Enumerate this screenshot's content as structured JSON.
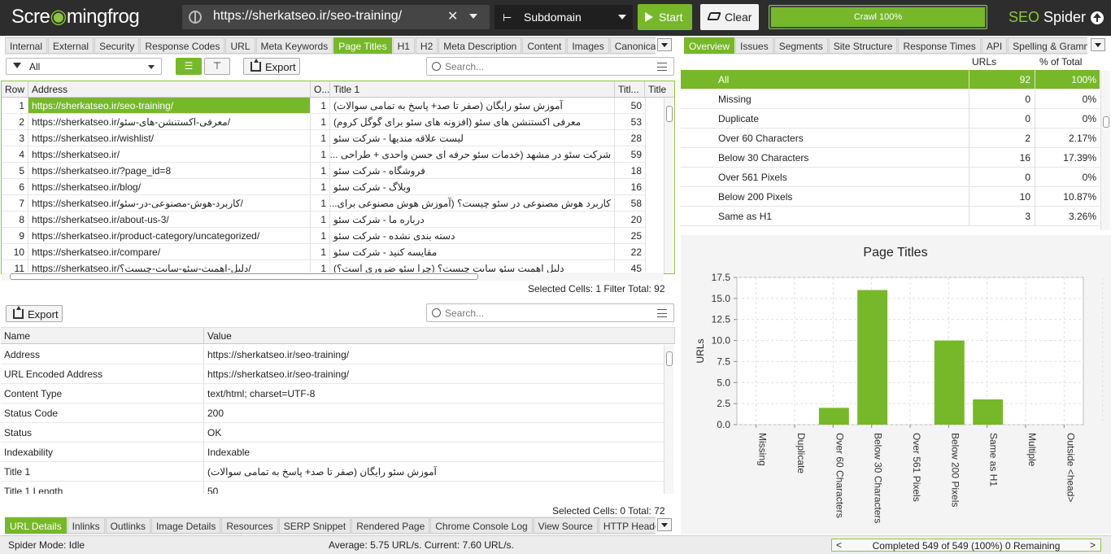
{
  "app": {
    "logo_a": "Scre",
    "logo_b": "mingfrog",
    "product_a": "SEO",
    "product_b": " Spider"
  },
  "toolbar": {
    "url": "https://sherkatseo.ir/seo-training/",
    "clear_x": "✕",
    "mode": "Subdomain",
    "start_label": "Start",
    "clear_label": "Clear",
    "crawl_label": "Crawl 100%",
    "crawl_progress": 1.0
  },
  "left_tabs": [
    "Internal",
    "External",
    "Security",
    "Response Codes",
    "URL",
    "Meta Keywords",
    "Page Titles",
    "H1",
    "H2",
    "Meta Description",
    "Content",
    "Images",
    "Canonica"
  ],
  "left_tabs_active": 6,
  "right_tabs": [
    "Overview",
    "Issues",
    "Segments",
    "Site Structure",
    "Response Times",
    "API",
    "Spelling & Gramm"
  ],
  "right_tabs_active": 0,
  "filter": {
    "value": "All"
  },
  "export_label": "Export",
  "search_placeholder": "Search...",
  "main_table": {
    "headers": [
      "Row",
      "Address",
      "O...",
      "Title 1",
      "Titl...",
      "Title"
    ],
    "rows": [
      [
        "1",
        "https://sherkatseo.ir/seo-training/",
        "1",
        "آموزش سئو رایگان (صفر تا صد+ پاسخ به تمامی سوالات)",
        "50"
      ],
      [
        "2",
        "https://sherkatseo.ir/معرفی-اکستنشن-های-سئو/",
        "1",
        "معرفی اکستنشن های سئو (افزونه های سئو برای گوگل کروم)",
        "53"
      ],
      [
        "3",
        "https://sherkatseo.ir/wishlist/",
        "1",
        "لیست علاقه مندیها - شرکت سئو",
        "28"
      ],
      [
        "4",
        "https://sherkatseo.ir/",
        "1",
        "شرکت سئو در مشهد (خدمات سئو حرفه ای حسن واحدی + طراحی ...",
        "59"
      ],
      [
        "5",
        "https://sherkatseo.ir/?page_id=8",
        "1",
        "فروشگاه - شرکت سئو",
        "18"
      ],
      [
        "6",
        "https://sherkatseo.ir/blog/",
        "1",
        "وبلاگ - شرکت سئو",
        "16"
      ],
      [
        "7",
        "https://sherkatseo.ir/کاربرد-هوش-مصنوعی-در-سئو/",
        "1",
        "کاربرد هوش مصنوعی در سئو چیست؟ (آموزش هوش مصنوعی برای...",
        "58"
      ],
      [
        "8",
        "https://sherkatseo.ir/about-us-3/",
        "1",
        "درباره ما - شرکت سئو",
        "20"
      ],
      [
        "9",
        "https://sherkatseo.ir/product-category/uncategorized/",
        "1",
        "دسته بندی نشده - شرکت سئو",
        "25"
      ],
      [
        "10",
        "https://sherkatseo.ir/compare/",
        "1",
        "مقایسه کنید - شرکت سئو",
        "22"
      ],
      [
        "11",
        "https://sherkatseo.ir/دلیل-اهمیت-سئو-سایت-چیست؟/",
        "1",
        "دلیل اهمیت سئو سایت چیست؟ (چرا سئو ضروری است؟)",
        "45"
      ]
    ],
    "status": "Selected Cells:  1  Filter Total:  92"
  },
  "details_table": {
    "headers": [
      "Name",
      "Value"
    ],
    "rows": [
      [
        "Address",
        "https://sherkatseo.ir/seo-training/"
      ],
      [
        "URL Encoded Address",
        "https://sherkatseo.ir/seo-training/"
      ],
      [
        "Content Type",
        "text/html; charset=UTF-8"
      ],
      [
        "Status Code",
        "200"
      ],
      [
        "Status",
        "OK"
      ],
      [
        "Indexability",
        "Indexable"
      ],
      [
        "Title 1",
        "آموزش سئو رایگان (صفر تا صد+ پاسخ به تمامی سوالات)"
      ],
      [
        "Title 1 Length",
        "50"
      ]
    ],
    "status": "Selected Cells:  0  Total:  72"
  },
  "bottom_tabs": [
    "URL Details",
    "Inlinks",
    "Outlinks",
    "Image Details",
    "Resources",
    "SERP Snippet",
    "Rendered Page",
    "Chrome Console Log",
    "View Source",
    "HTTP Heade"
  ],
  "bottom_tabs_active": 0,
  "overview": {
    "headers": [
      "URLs",
      "% of Total"
    ],
    "rows": [
      [
        "All",
        "92",
        "100%"
      ],
      [
        "Missing",
        "0",
        "0%"
      ],
      [
        "Duplicate",
        "0",
        "0%"
      ],
      [
        "Over 60 Characters",
        "2",
        "2.17%"
      ],
      [
        "Below 30 Characters",
        "16",
        "17.39%"
      ],
      [
        "Over 561 Pixels",
        "0",
        "0%"
      ],
      [
        "Below 200 Pixels",
        "10",
        "10.87%"
      ],
      [
        "Same as H1",
        "3",
        "3.26%"
      ]
    ]
  },
  "chart_data": {
    "type": "bar",
    "title": "Page Titles",
    "ylabel": "URLs",
    "xlabel": "",
    "categories": [
      "Missing",
      "Duplicate",
      "Over 60 Characters",
      "Below 30 Characters",
      "Over 561 Pixels",
      "Below 200 Pixels",
      "Same as H1",
      "Multiple",
      "Outside <head>"
    ],
    "values": [
      0,
      0,
      2,
      16,
      0,
      10,
      3,
      0,
      0
    ],
    "ylim": [
      0,
      17.5
    ],
    "yticks": [
      "0.0",
      "2.5",
      "5.0",
      "7.5",
      "10.0",
      "12.5",
      "15.0",
      "17.5"
    ],
    "bar_color": "#76b82a",
    "grid": true
  },
  "footer": {
    "mode": "Spider Mode: Idle",
    "speed": "Average: 5.75 URL/s. Current: 7.60 URL/s.",
    "completed": "Completed 549 of 549 (100%) 0 Remaining",
    "prev": "<",
    "next": ">"
  },
  "colors": {
    "accent": "#76b82a",
    "dark": "#2d2d2d"
  }
}
